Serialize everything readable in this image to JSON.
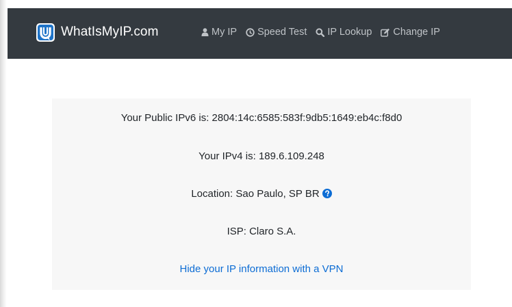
{
  "site": {
    "brand": "WhatIsMyIP.com"
  },
  "nav": {
    "items": [
      {
        "label": "My IP",
        "icon": "user-icon"
      },
      {
        "label": "Speed Test",
        "icon": "gauge-icon"
      },
      {
        "label": "IP Lookup",
        "icon": "search-icon"
      },
      {
        "label": "Change IP",
        "icon": "edit-icon"
      }
    ]
  },
  "info": {
    "ipv6": "Your Public IPv6 is: 2804:14c:6585:583f:9db5:1649:eb4c:f8d0",
    "ipv4": "Your IPv4 is: 189.6.109.248",
    "location": "Location: Sao Paulo, SP BR",
    "isp": "ISP: Claro S.A.",
    "vpn_link": "Hide your IP information with a VPN"
  },
  "colors": {
    "navbar": "#343a40",
    "nav_text": "#bfc3c7",
    "link": "#0c6cd4",
    "info_bg": "#f7f7f7",
    "logo": "#1e73c8"
  }
}
